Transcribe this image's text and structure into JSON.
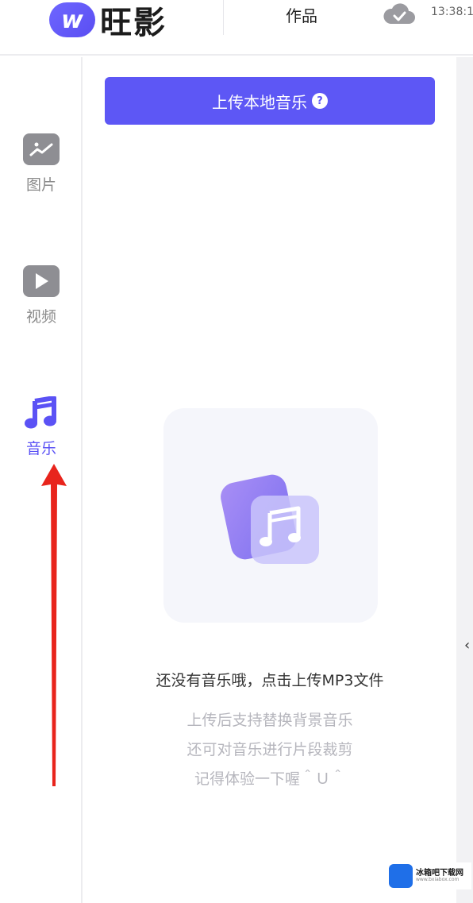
{
  "header": {
    "logo_glyph": "w",
    "logo_text": "旺影",
    "works_label": "作品",
    "time": "13:38:1",
    "cloud_icon": "cloud-check-icon"
  },
  "nav": {
    "items": [
      {
        "label": "图片",
        "icon": "image-icon",
        "active": false
      },
      {
        "label": "视频",
        "icon": "play-icon",
        "active": false
      },
      {
        "label": "音乐",
        "icon": "music-note-icon",
        "active": true
      }
    ]
  },
  "main": {
    "upload_label": "上传本地音乐",
    "help_glyph": "?",
    "empty_title": "还没有音乐哦，点击上传MP3文件",
    "tips": [
      "上传后支持替换背景音乐",
      "还可对音乐进行片段裁剪",
      "记得体验一下喔＾Ｕ＾"
    ],
    "collapse_glyph": "‹"
  },
  "watermark": {
    "name": "冰箱吧下载网",
    "sub": "www.bxiabox.com"
  },
  "colors": {
    "accent": "#5d57f5",
    "nav_active": "#5b52f5",
    "annotation": "#e8241c"
  }
}
